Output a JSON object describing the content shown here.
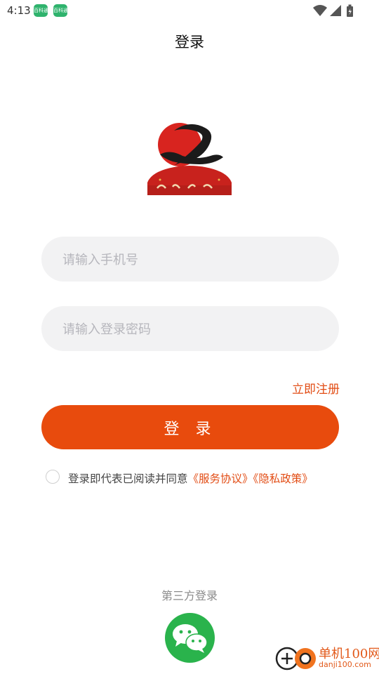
{
  "status_bar": {
    "time": "4:13",
    "badges": [
      "百科通",
      "百科通"
    ]
  },
  "header": {
    "title": "登录"
  },
  "form": {
    "phone_placeholder": "请输入手机号",
    "password_placeholder": "请输入登录密码",
    "register_link": "立即注册",
    "login_button": "登 录"
  },
  "agreement": {
    "prefix": "登录即代表已阅读并同意",
    "service_link": "《服务协议》",
    "privacy_link": "《隐私政策》"
  },
  "third_party": {
    "label": "第三方登录"
  },
  "watermark": {
    "title": "单机100网",
    "subtitle": "danji100.com"
  },
  "colors": {
    "accent": "#e84b0d",
    "link": "#e24c14",
    "wechat": "#2ab34c",
    "input_bg": "#f2f2f3"
  },
  "icons": [
    "wifi-icon",
    "signal-icon",
    "battery-icon",
    "app-logo-icon",
    "wechat-icon"
  ]
}
